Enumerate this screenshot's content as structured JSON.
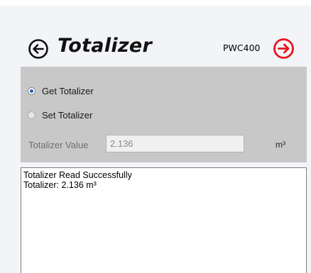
{
  "header": {
    "title": "Totalizer",
    "model": "PWC400",
    "back_icon": "circle-arrow-left-icon",
    "forward_icon": "circle-arrow-right-icon",
    "forward_color": "#e8141e"
  },
  "options": {
    "get_label": "Get Totalizer",
    "set_label": "Set Totalizer",
    "selected": "get",
    "field_label": "Totalizer Value",
    "field_value": "2.136",
    "unit": "m³"
  },
  "log": {
    "lines": [
      "Totalizer Read Successfully",
      "Totalizer: 2.136 m³"
    ]
  },
  "colors": {
    "options_bg": "#c8c8c8",
    "radio_selected": "#1f5fb8"
  }
}
